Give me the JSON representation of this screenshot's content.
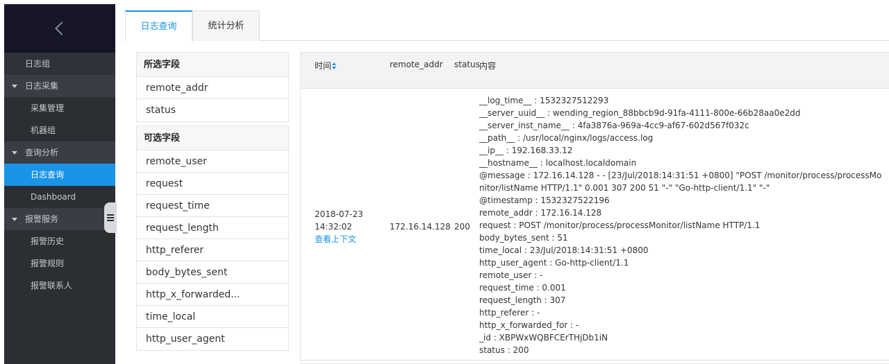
{
  "sidebar": {
    "items": [
      {
        "label": "日志组",
        "type": "l1"
      },
      {
        "label": "日志采集",
        "type": "group"
      },
      {
        "label": "采集管理",
        "type": "l2"
      },
      {
        "label": "机器组",
        "type": "l2"
      },
      {
        "label": "查询分析",
        "type": "group"
      },
      {
        "label": "日志查询",
        "type": "l2",
        "active": true
      },
      {
        "label": "Dashboard",
        "type": "l2"
      },
      {
        "label": "报警服务",
        "type": "group"
      },
      {
        "label": "报警历史",
        "type": "l2"
      },
      {
        "label": "报警规则",
        "type": "l2"
      },
      {
        "label": "报警联系人",
        "type": "l2"
      }
    ]
  },
  "tabs": [
    {
      "label": "日志查询",
      "active": true
    },
    {
      "label": "统计分析",
      "active": false
    }
  ],
  "fields": {
    "selected_title": "所选字段",
    "selected": [
      "remote_addr",
      "status"
    ],
    "optional_title": "可选字段",
    "optional": [
      "remote_user",
      "request",
      "request_time",
      "request_length",
      "http_referer",
      "body_bytes_sent",
      "http_x_forwarded...",
      "time_local",
      "http_user_agent"
    ]
  },
  "table": {
    "headers": {
      "time": "时间",
      "addr": "remote_addr",
      "status": "status",
      "content": "内容"
    },
    "row": {
      "date": "2018-07-23",
      "time": "14:32:02",
      "context_link": "查看上下文",
      "remote_addr": "172.16.14.128",
      "status": "200",
      "content": [
        "__log_time__ : 1532327512293",
        "__server_uuid__ : wending_region_88bbcb9d-91fa-4111-800e-66b28aa0e2dd",
        "__server_inst_name__ : 4fa3876a-969a-4cc9-af67-602d567f032c",
        "__path__ : /usr/local/nginx/logs/access.log",
        "__ip__ : 192.168.33.12",
        "__hostname__ : localhost.localdomain",
        "@message : 172.16.14.128 - - [23/Jul/2018:14:31:51 +0800] \"POST /monitor/process/processMonitor/listName HTTP/1.1\" 0.001 307 200 51 \"-\" \"Go-http-client/1.1\" \"-\"",
        "@timestamp : 1532327522196",
        "remote_addr : 172.16.14.128",
        "request : POST /monitor/process/processMonitor/listName HTTP/1.1",
        "body_bytes_sent : 51",
        "time_local : 23/Jul/2018:14:31:51 +0800",
        "http_user_agent : Go-http-client/1.1",
        "remote_user : -",
        "request_time : 0.001",
        "request_length : 307",
        "http_referer : -",
        "http_x_forwarded_for : -",
        "_id : XBPWxWQBFCErTHjDb1iN",
        "status : 200"
      ]
    }
  }
}
